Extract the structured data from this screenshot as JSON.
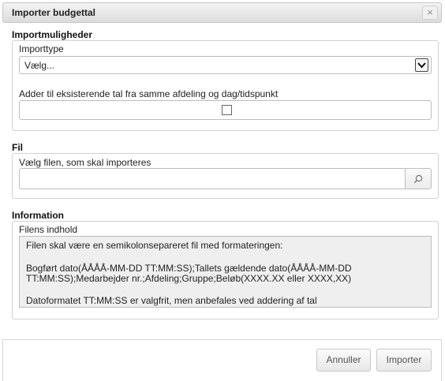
{
  "dialog": {
    "title": "Importer budgettal",
    "close_symbol": "×"
  },
  "import_options": {
    "section_title": "Importmuligheder",
    "type_label": "Importtype",
    "type_selected": "Vælg...",
    "add_label": "Adder til eksisterende tal fra samme afdeling og dag/tidspunkt",
    "add_checked": false
  },
  "file": {
    "section_title": "Fil",
    "label": "Vælg filen, som skal importeres",
    "value": "",
    "browse_icon": "search-icon"
  },
  "information": {
    "section_title": "Information",
    "content_label": "Filens indhold",
    "line1": "Filen skal være en semikolonsepareret fil med formateringen:",
    "line2a": "Bogført dato(ÅÅÅÅ-MM-DD TT:MM:SS);Tallets gældende dato(ÅÅÅÅ-MM-DD",
    "line2b": "TT:MM:SS);Medarbejder nr.;Afdeling;Gruppe;Beløb(XXXX.XX eller XXXX,XX)",
    "line3": "Datoformatet TT:MM:SS er valgfrit, men anbefales ved addering af tal"
  },
  "footer": {
    "cancel_label": "Annuller",
    "import_label": "Importer"
  }
}
